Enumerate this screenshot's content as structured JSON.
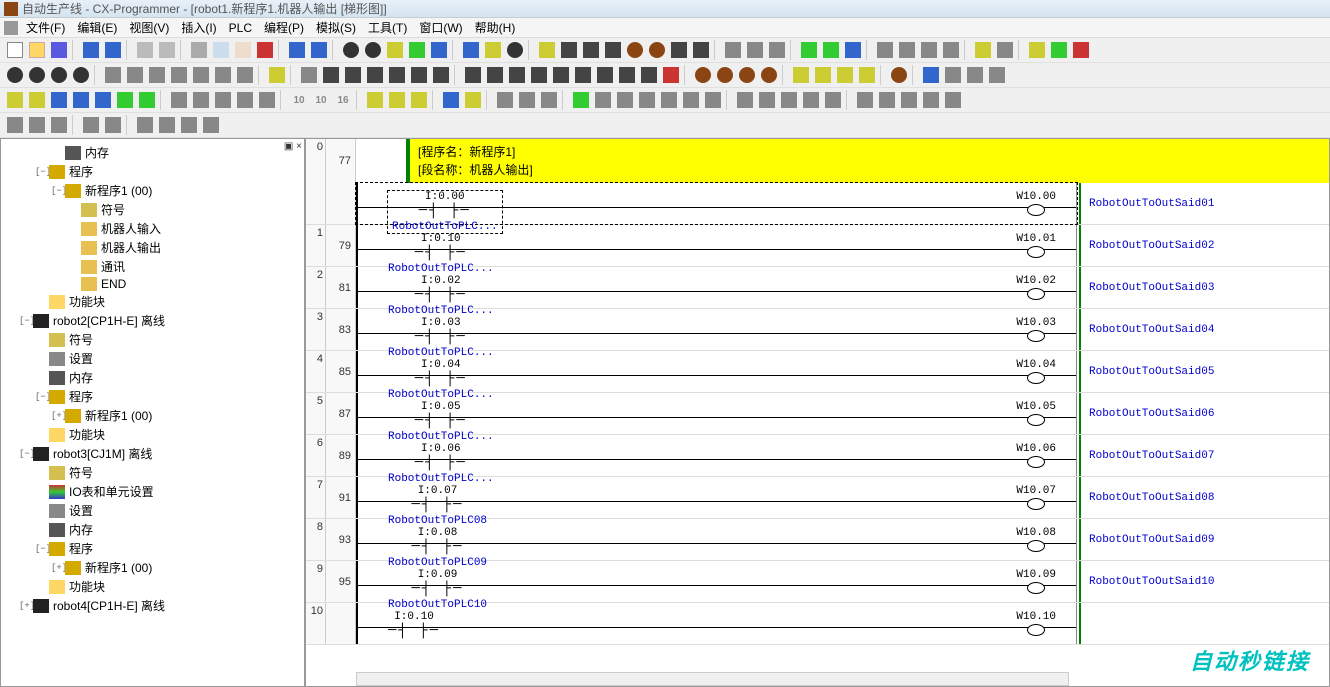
{
  "title": "自动生产线 - CX-Programmer - [robot1.新程序1.机器人输出 [梯形图]]",
  "menu": [
    "文件(F)",
    "编辑(E)",
    "视图(V)",
    "插入(I)",
    "PLC",
    "编程(P)",
    "模拟(S)",
    "工具(T)",
    "窗口(W)",
    "帮助(H)"
  ],
  "tree": {
    "items": [
      {
        "depth": 3,
        "toggle": "",
        "ico": "i-mem",
        "label": "内存"
      },
      {
        "depth": 2,
        "toggle": "−",
        "ico": "i-prog",
        "label": "程序"
      },
      {
        "depth": 3,
        "toggle": "−",
        "ico": "i-prog",
        "label": "新程序1 (00)"
      },
      {
        "depth": 4,
        "toggle": "",
        "ico": "i-sym",
        "label": "符号"
      },
      {
        "depth": 4,
        "toggle": "",
        "ico": "i-sect",
        "label": "机器人输入"
      },
      {
        "depth": 4,
        "toggle": "",
        "ico": "i-sect",
        "label": "机器人输出"
      },
      {
        "depth": 4,
        "toggle": "",
        "ico": "i-sect",
        "label": "通讯"
      },
      {
        "depth": 4,
        "toggle": "",
        "ico": "i-sect",
        "label": "END"
      },
      {
        "depth": 2,
        "toggle": "",
        "ico": "i-folder",
        "label": "功能块"
      },
      {
        "depth": 1,
        "toggle": "−",
        "ico": "i-plc",
        "label": "robot2[CP1H-E] 离线"
      },
      {
        "depth": 2,
        "toggle": "",
        "ico": "i-sym",
        "label": "符号"
      },
      {
        "depth": 2,
        "toggle": "",
        "ico": "i-set",
        "label": "设置"
      },
      {
        "depth": 2,
        "toggle": "",
        "ico": "i-mem",
        "label": "内存"
      },
      {
        "depth": 2,
        "toggle": "−",
        "ico": "i-prog",
        "label": "程序"
      },
      {
        "depth": 3,
        "toggle": "+",
        "ico": "i-prog",
        "label": "新程序1 (00)"
      },
      {
        "depth": 2,
        "toggle": "",
        "ico": "i-folder",
        "label": "功能块"
      },
      {
        "depth": 1,
        "toggle": "−",
        "ico": "i-plc",
        "label": "robot3[CJ1M] 离线"
      },
      {
        "depth": 2,
        "toggle": "",
        "ico": "i-sym",
        "label": "符号"
      },
      {
        "depth": 2,
        "toggle": "",
        "ico": "i-io",
        "label": "IO表和单元设置"
      },
      {
        "depth": 2,
        "toggle": "",
        "ico": "i-set",
        "label": "设置"
      },
      {
        "depth": 2,
        "toggle": "",
        "ico": "i-mem",
        "label": "内存"
      },
      {
        "depth": 2,
        "toggle": "−",
        "ico": "i-prog",
        "label": "程序"
      },
      {
        "depth": 3,
        "toggle": "+",
        "ico": "i-prog",
        "label": "新程序1 (00)"
      },
      {
        "depth": 2,
        "toggle": "",
        "ico": "i-folder",
        "label": "功能块"
      },
      {
        "depth": 1,
        "toggle": "+",
        "ico": "i-plc",
        "label": "robot4[CP1H-E] 离线"
      }
    ]
  },
  "header": {
    "line1": "[程序名：新程序1]",
    "line2": "[段名称：机器人输出]",
    "first_step": "77"
  },
  "rungs": [
    {
      "n": "0",
      "step": "77",
      "in": "I:0.00",
      "desc": "RobotOutToPLC...",
      "out": "W10.00",
      "cmt": "RobotOutToOutSaid01",
      "sel": true
    },
    {
      "n": "1",
      "step": "79",
      "in": "I:0.10",
      "desc": "RobotOutToPLC...",
      "out": "W10.01",
      "cmt": "RobotOutToOutSaid02"
    },
    {
      "n": "2",
      "step": "81",
      "in": "I:0.02",
      "desc": "RobotOutToPLC...",
      "out": "W10.02",
      "cmt": "RobotOutToOutSaid03"
    },
    {
      "n": "3",
      "step": "83",
      "in": "I:0.03",
      "desc": "RobotOutToPLC...",
      "out": "W10.03",
      "cmt": "RobotOutToOutSaid04"
    },
    {
      "n": "4",
      "step": "85",
      "in": "I:0.04",
      "desc": "RobotOutToPLC...",
      "out": "W10.04",
      "cmt": "RobotOutToOutSaid05"
    },
    {
      "n": "5",
      "step": "87",
      "in": "I:0.05",
      "desc": "RobotOutToPLC...",
      "out": "W10.05",
      "cmt": "RobotOutToOutSaid06"
    },
    {
      "n": "6",
      "step": "89",
      "in": "I:0.06",
      "desc": "RobotOutToPLC...",
      "out": "W10.06",
      "cmt": "RobotOutToOutSaid07"
    },
    {
      "n": "7",
      "step": "91",
      "in": "I:0.07",
      "desc": "RobotOutToPLC08",
      "out": "W10.07",
      "cmt": "RobotOutToOutSaid08"
    },
    {
      "n": "8",
      "step": "93",
      "in": "I:0.08",
      "desc": "RobotOutToPLC09",
      "out": "W10.08",
      "cmt": "RobotOutToOutSaid09"
    },
    {
      "n": "9",
      "step": "95",
      "in": "I:0.09",
      "desc": "RobotOutToPLC10",
      "out": "W10.09",
      "cmt": "RobotOutToOutSaid10"
    },
    {
      "n": "10",
      "step": "",
      "in": "I:0.10",
      "desc": "",
      "out": "W10.10",
      "cmt": ""
    }
  ],
  "watermark": "自动秒链接",
  "toolbar_numbers": [
    "10",
    "10",
    "16"
  ]
}
